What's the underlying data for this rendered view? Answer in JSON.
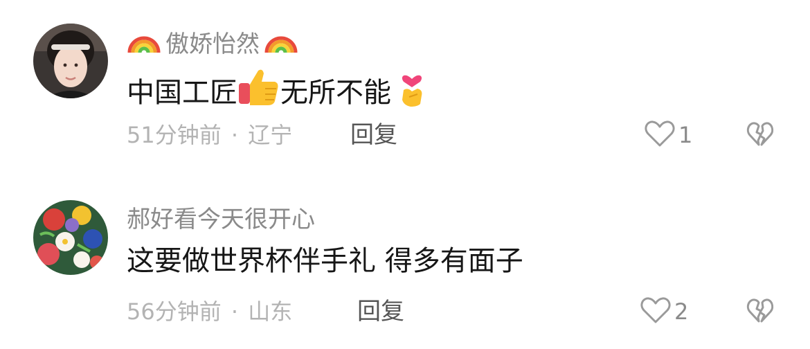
{
  "comments": [
    {
      "username": "傲娇怡然",
      "username_decor_icon": "rainbow-emoji",
      "text_before": "中国工匠",
      "text_after": "无所不能",
      "emojis": [
        "thumbs-up-emoji",
        "finger-heart-emoji"
      ],
      "time": "51分钟前",
      "location": "辽宁",
      "reply_label": "回复",
      "likes": "1"
    },
    {
      "username": "郝好看今天很开心",
      "text": "这要做世界杯伴手礼 得多有面子",
      "time": "56分钟前",
      "location": "山东",
      "reply_label": "回复",
      "likes": "2"
    }
  ],
  "meta_separator": "·",
  "icons": {
    "like": "heart-outline-icon",
    "dislike": "broken-heart-icon"
  },
  "colors": {
    "username": "#8a8a8a",
    "content": "#161616",
    "meta": "#b3b3b3",
    "reply": "#555555",
    "icon_gray": "#9a9a9a"
  }
}
